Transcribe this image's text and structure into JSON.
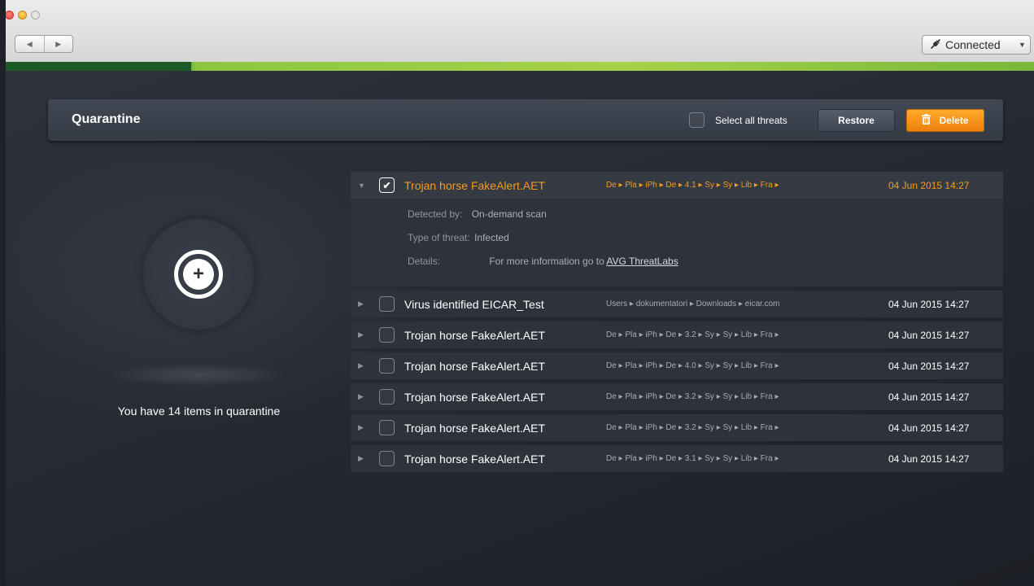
{
  "window": {
    "connection": {
      "label": "Connected",
      "icon": "plug-icon"
    }
  },
  "header": {
    "title": "Quarantine",
    "select_all_label": "Select all threats",
    "restore_label": "Restore",
    "delete_label": "Delete"
  },
  "left_panel": {
    "count_text": "You have 14 items in quarantine"
  },
  "threats": [
    {
      "name": "Trojan horse FakeAlert.AET",
      "path": "De ▸ Pla ▸ iPh ▸ De ▸ 4.1 ▸ Sy ▸ Sy ▸ Lib ▸ Fra ▸",
      "date": "04 Jun 2015 14:27",
      "checked": true,
      "expanded": true
    },
    {
      "name": "Virus identified EICAR_Test",
      "path": "Users ▸ dokumentatori ▸ Downloads ▸ eicar.com",
      "date": "04 Jun 2015 14:27",
      "checked": false,
      "expanded": false
    },
    {
      "name": "Trojan horse FakeAlert.AET",
      "path": "De ▸ Pla ▸ iPh ▸ De ▸ 3.2 ▸ Sy ▸ Sy ▸ Lib ▸ Fra ▸",
      "date": "04 Jun 2015 14:27",
      "checked": false,
      "expanded": false
    },
    {
      "name": "Trojan horse FakeAlert.AET",
      "path": "De ▸ Pla ▸ iPh ▸ De ▸ 4.0 ▸ Sy ▸ Sy ▸ Lib ▸ Fra ▸",
      "date": "04 Jun 2015 14:27",
      "checked": false,
      "expanded": false
    },
    {
      "name": "Trojan horse FakeAlert.AET",
      "path": "De ▸ Pla ▸ iPh ▸ De ▸ 3.2 ▸ Sy ▸ Sy ▸ Lib ▸ Fra ▸",
      "date": "04 Jun 2015 14:27",
      "checked": false,
      "expanded": false
    },
    {
      "name": "Trojan horse FakeAlert.AET",
      "path": "De ▸ Pla ▸ iPh ▸ De ▸ 3.2 ▸ Sy ▸ Sy ▸ Lib ▸ Fra ▸",
      "date": "04 Jun 2015 14:27",
      "checked": false,
      "expanded": false
    },
    {
      "name": "Trojan horse FakeAlert.AET",
      "path": "De ▸ Pla ▸ iPh ▸ De ▸ 3.1 ▸ Sy ▸ Sy ▸ Lib ▸ Fra ▸",
      "date": "04 Jun 2015 14:27",
      "checked": false,
      "expanded": false
    }
  ],
  "details": {
    "detected_by_label": "Detected by:",
    "detected_by_value": "On-demand scan",
    "type_label": "Type of threat:",
    "type_value": "Infected",
    "details_label": "Details:",
    "details_text": "For more information go to",
    "details_link": "AVG ThreatLabs"
  },
  "colors": {
    "accent_orange": "#f39c1e",
    "accent_green": "#8cc63f",
    "background": "#22262d"
  }
}
